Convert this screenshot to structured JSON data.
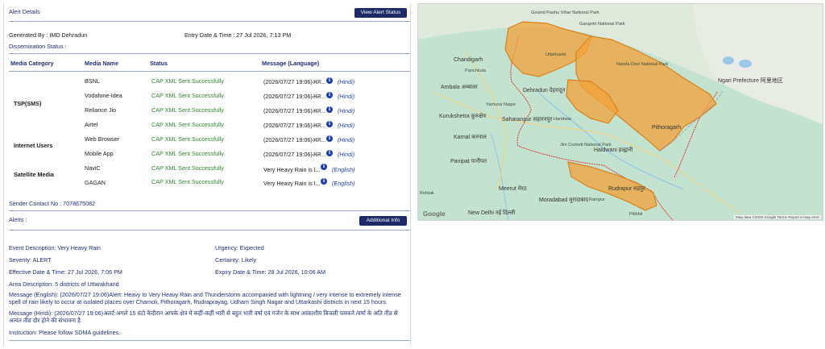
{
  "alert_details": {
    "title": "Alert Details",
    "view_status_button": "View Alert Status",
    "generated_by": "Generated By : IMD Dehradun",
    "entry_datetime": "Entry Date & Time : 27 Jul 2026, 7:13 PM",
    "dissemination_status": "Dissemination Status :",
    "columns": [
      "Media Category",
      "Media Name",
      "Status",
      "Message (Language)"
    ],
    "categories": [
      "TSP(SMS)",
      "Internet Users",
      "Satellite Media"
    ],
    "rows": [
      {
        "media": "BSNL",
        "status": "CAP XML Sent Successfully",
        "message": "(2026/07/27 19:06)अल...",
        "language": "(Hindi)"
      },
      {
        "media": "Vodafone-Idea",
        "status": "CAP XML Sent Successfully",
        "message": "(2026/07/27 19:06)अल...",
        "language": "(Hindi)"
      },
      {
        "media": "Reliance Jio",
        "status": "CAP XML Sent Successfully",
        "message": "(2026/07/27 19:06)अल...",
        "language": "(Hindi)"
      },
      {
        "media": "Airtel",
        "status": "CAP XML Sent Successfully",
        "message": "(2026/07/27 19:06)अल...",
        "language": "(Hindi)"
      },
      {
        "media": "Web Browser",
        "status": "CAP XML Sent Successfully",
        "message": "(2026/07/27 19:06)अल...",
        "language": "(Hindi)"
      },
      {
        "media": "Mobile App",
        "status": "CAP XML Sent Successfully",
        "message": "(2026/07/27 19:06)अल...",
        "language": "(Hindi)"
      },
      {
        "media": "NaviC",
        "status": "CAP XML Sent Successfully",
        "message": "Very Heavy Rain is l...",
        "language": "(English)"
      },
      {
        "media": "GAGAN",
        "status": "CAP XML Sent Successfully",
        "message": "Very Heavy Rain is l...",
        "language": "(English)"
      }
    ],
    "sender_contact": "Sender Contact No : 7078675082"
  },
  "alerts": {
    "title": "Alerts :",
    "additional_info_button": "Additional Info",
    "event_description": "Event Description: Very Heavy Rain",
    "urgency": "Urgency: Expected",
    "severity": "Severity: ALERT",
    "certainty": "Certainty: Likely",
    "effective": "Effective Date & Time: 27 Jul 2026, 7:06 PM",
    "expiry": "Expiry Date & Time: 28 Jul 2026, 10:06 AM",
    "area": "Area Description: 5 districts of Uttarakhand",
    "message_english": "Message (English): (2026/07/27 19:06)Alert: Heavy to Very Heavy Rain and Thunderstorm accompanied with lightning / very intense to extremely intense spell of rain likely to occur at isolated places over Chamoli, Pithoragarh, Rudraprayag, Udham Singh Nagar and Uttarkashi districts in next 15 hours.",
    "message_hindi": "Message (Hindi): (2026/07/27 19:06)अलर्ट:अगले 15 घंटो केदौरान आपके क्षेत्र में कहीं-कहीं भारी से बहुत भारी वर्षा एवं गर्जन के साथ आकाशीय बिजली चमकने /वर्षा के अति तीव्र से अत्यंत तीव्र दौर होने की संभावना है",
    "instruction": "Instruction: Please follow SDMA guidelines."
  },
  "map": {
    "labels": [
      "Govind Pashu Vihar National Park",
      "Gangotri National Park",
      "Uttarkashi",
      "Dehradun देहरादून",
      "Chandigarh",
      "Panchkula",
      "Ambala अम्बाला",
      "Yamuna Nagar",
      "Kurukshetra कुरुक्षेत्र",
      "Saharanpur सहारनपुर",
      "Haridwar",
      "Karnal करनाल",
      "Panipat पानीपत",
      "Jim Corbett National Park",
      "Haldwani हल्द्वानी",
      "Rudrapur रुद्रपुर",
      "Meerut मेरठ",
      "Moradabad मुरादाबाद",
      "Rampur",
      "New Delhi नई दिल्ली",
      "Rohtak",
      "Ngari Prefecture 阿里地区",
      "Nanda Devi National Park",
      "Pithoragarh",
      "Pilibhit"
    ],
    "brand": "Google",
    "attribution": "Map data ©2026 Google   Terms   Report a map error",
    "colors": {
      "alert_fill": "#f2a23a",
      "alert_stroke": "#d9801c",
      "border": "#d93636",
      "land": "#bfe1cf"
    }
  }
}
